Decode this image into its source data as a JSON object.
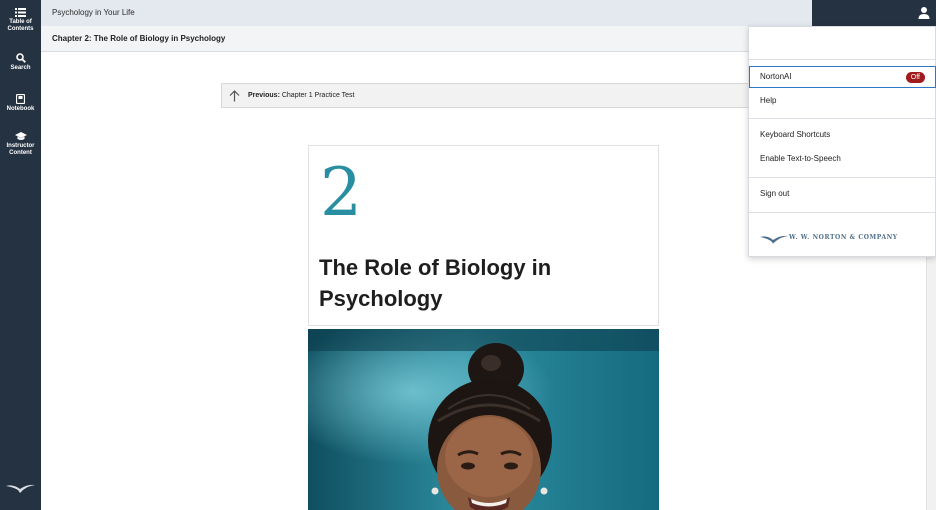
{
  "sidebar": {
    "items": [
      {
        "label": "Table of\nContents",
        "icon": "list-icon"
      },
      {
        "label": "Search",
        "icon": "search-icon"
      },
      {
        "label": "Notebook",
        "icon": "notebook-icon"
      },
      {
        "label": "Instructor\nContent",
        "icon": "graduation-cap-icon"
      }
    ],
    "logo": "norton-seagull-logo"
  },
  "header": {
    "book_title": "Psychology in Your Life",
    "user_icon": "user-icon"
  },
  "chapter_bar": {
    "title": "Chapter 2: The Role of Biology in Psychology"
  },
  "content": {
    "previous": {
      "prefix": "Previous:",
      "title": "Chapter 1 Practice Test"
    },
    "chapter_number": "2",
    "chapter_heading": "The Role of Biology in Psychology"
  },
  "menu": {
    "items": [
      {
        "label": "NortonAI",
        "badge": "Off"
      },
      {
        "label": "Help"
      },
      {
        "label": "Keyboard Shortcuts"
      },
      {
        "label": "Enable Text-to-Speech"
      },
      {
        "label": "Sign out"
      }
    ],
    "publisher": "W. W. NORTON & COMPANY"
  },
  "colors": {
    "sidebar_bg": "#253241",
    "accent_teal": "#2a8ea2",
    "badge_red": "#a01c1c",
    "focus_blue": "#2d78c2"
  }
}
